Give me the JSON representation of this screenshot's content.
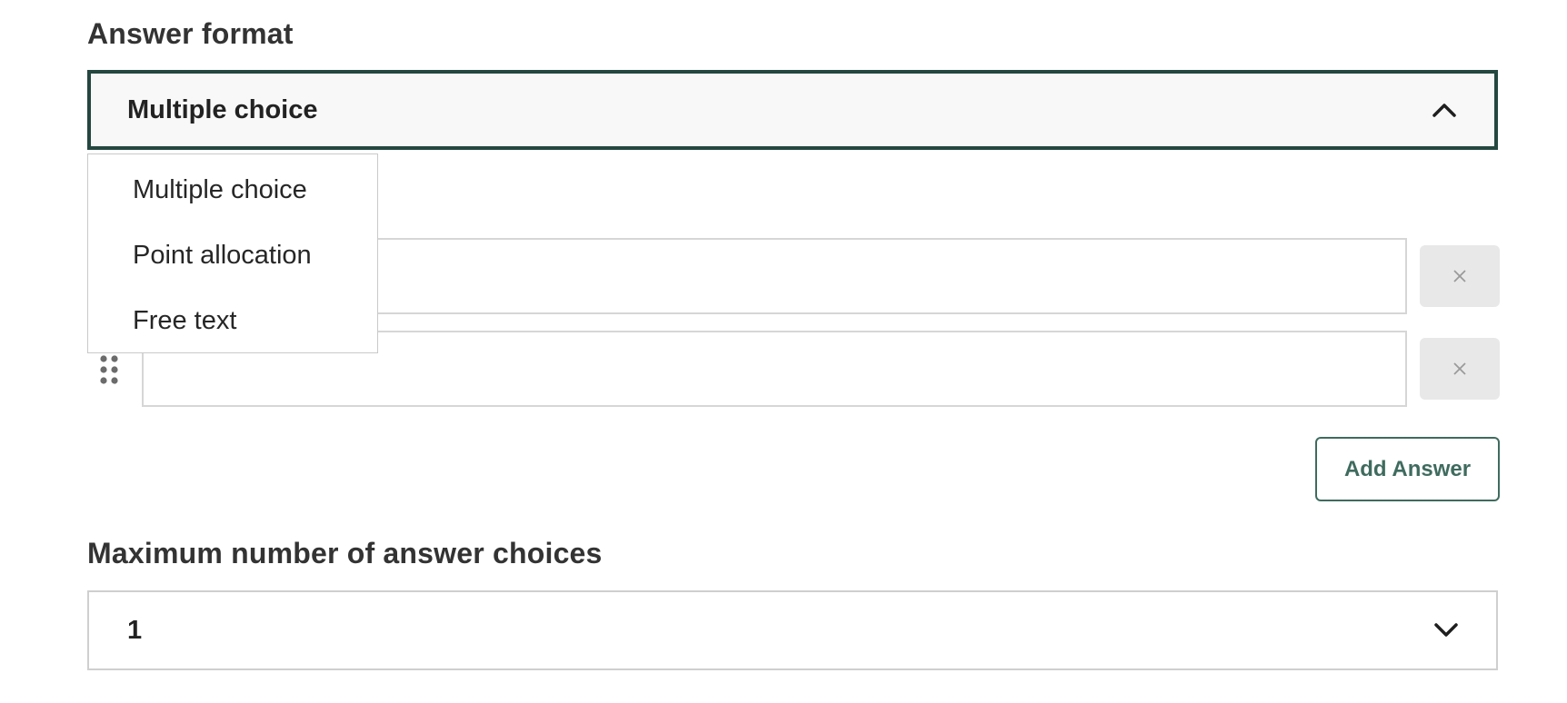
{
  "answer_format": {
    "label": "Answer format",
    "selected_value": "Multiple choice",
    "expanded": true,
    "options": [
      "Multiple choice",
      "Point allocation",
      "Free text"
    ]
  },
  "answers": {
    "items": [
      {
        "value": ""
      },
      {
        "value": ""
      }
    ],
    "remove_icon": "close-icon",
    "drag_icon": "drag-handle-icon",
    "add_label": "Add Answer"
  },
  "max_choices": {
    "label": "Maximum number of answer choices",
    "selected_value": "1"
  },
  "colors": {
    "accent": "#3f6b5e",
    "focus_border": "#24473f",
    "remove_button_bg": "#e8e8e8",
    "field_border": "#d6d6d6"
  }
}
